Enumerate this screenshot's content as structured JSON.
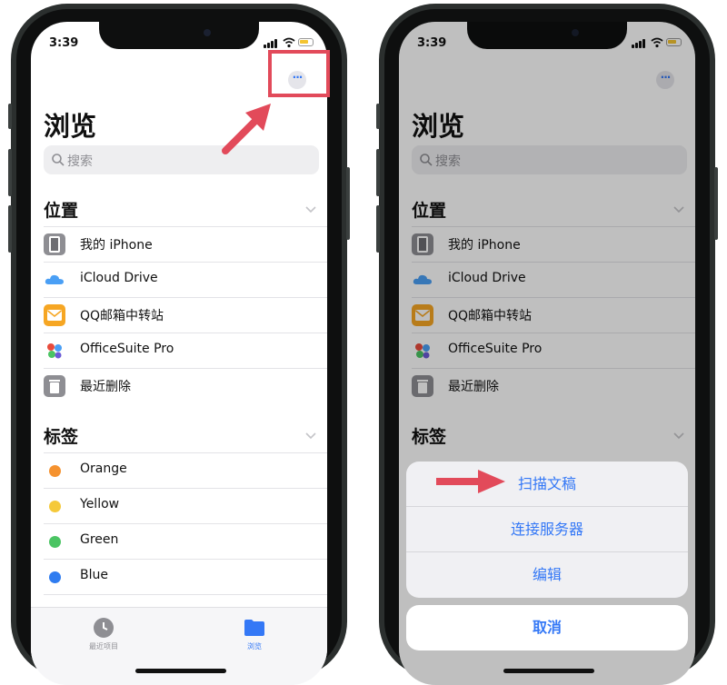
{
  "status": {
    "time": "3:39"
  },
  "browse": {
    "title": "浏览",
    "more_icon": "ellipsis-icon",
    "search_placeholder": "搜索",
    "locations_header": "位置",
    "locations": [
      {
        "label": "我的 iPhone",
        "icon": "iphone-icon"
      },
      {
        "label": "iCloud Drive",
        "icon": "icloud-icon"
      },
      {
        "label": "QQ邮箱中转站",
        "icon": "qq-mail-icon"
      },
      {
        "label": "OfficeSuite Pro",
        "icon": "officesuite-icon"
      },
      {
        "label": "最近删除",
        "icon": "trash-icon"
      }
    ],
    "tags_header": "标签",
    "tags": [
      {
        "label": "Orange",
        "color": "#f5922f"
      },
      {
        "label": "Yellow",
        "color": "#f5c93a"
      },
      {
        "label": "Green",
        "color": "#4bc463"
      },
      {
        "label": "Blue",
        "color": "#2f7cf0"
      }
    ],
    "purple_tag_color": "#a259d9"
  },
  "tabbar": {
    "recents_label": "最近项目",
    "browse_label": "浏览",
    "accent": "#3478f6"
  },
  "action_sheet": {
    "options": [
      "扫描文稿",
      "连接服务器",
      "编辑"
    ],
    "cancel": "取消"
  },
  "annotation_color": "#e24a5a"
}
